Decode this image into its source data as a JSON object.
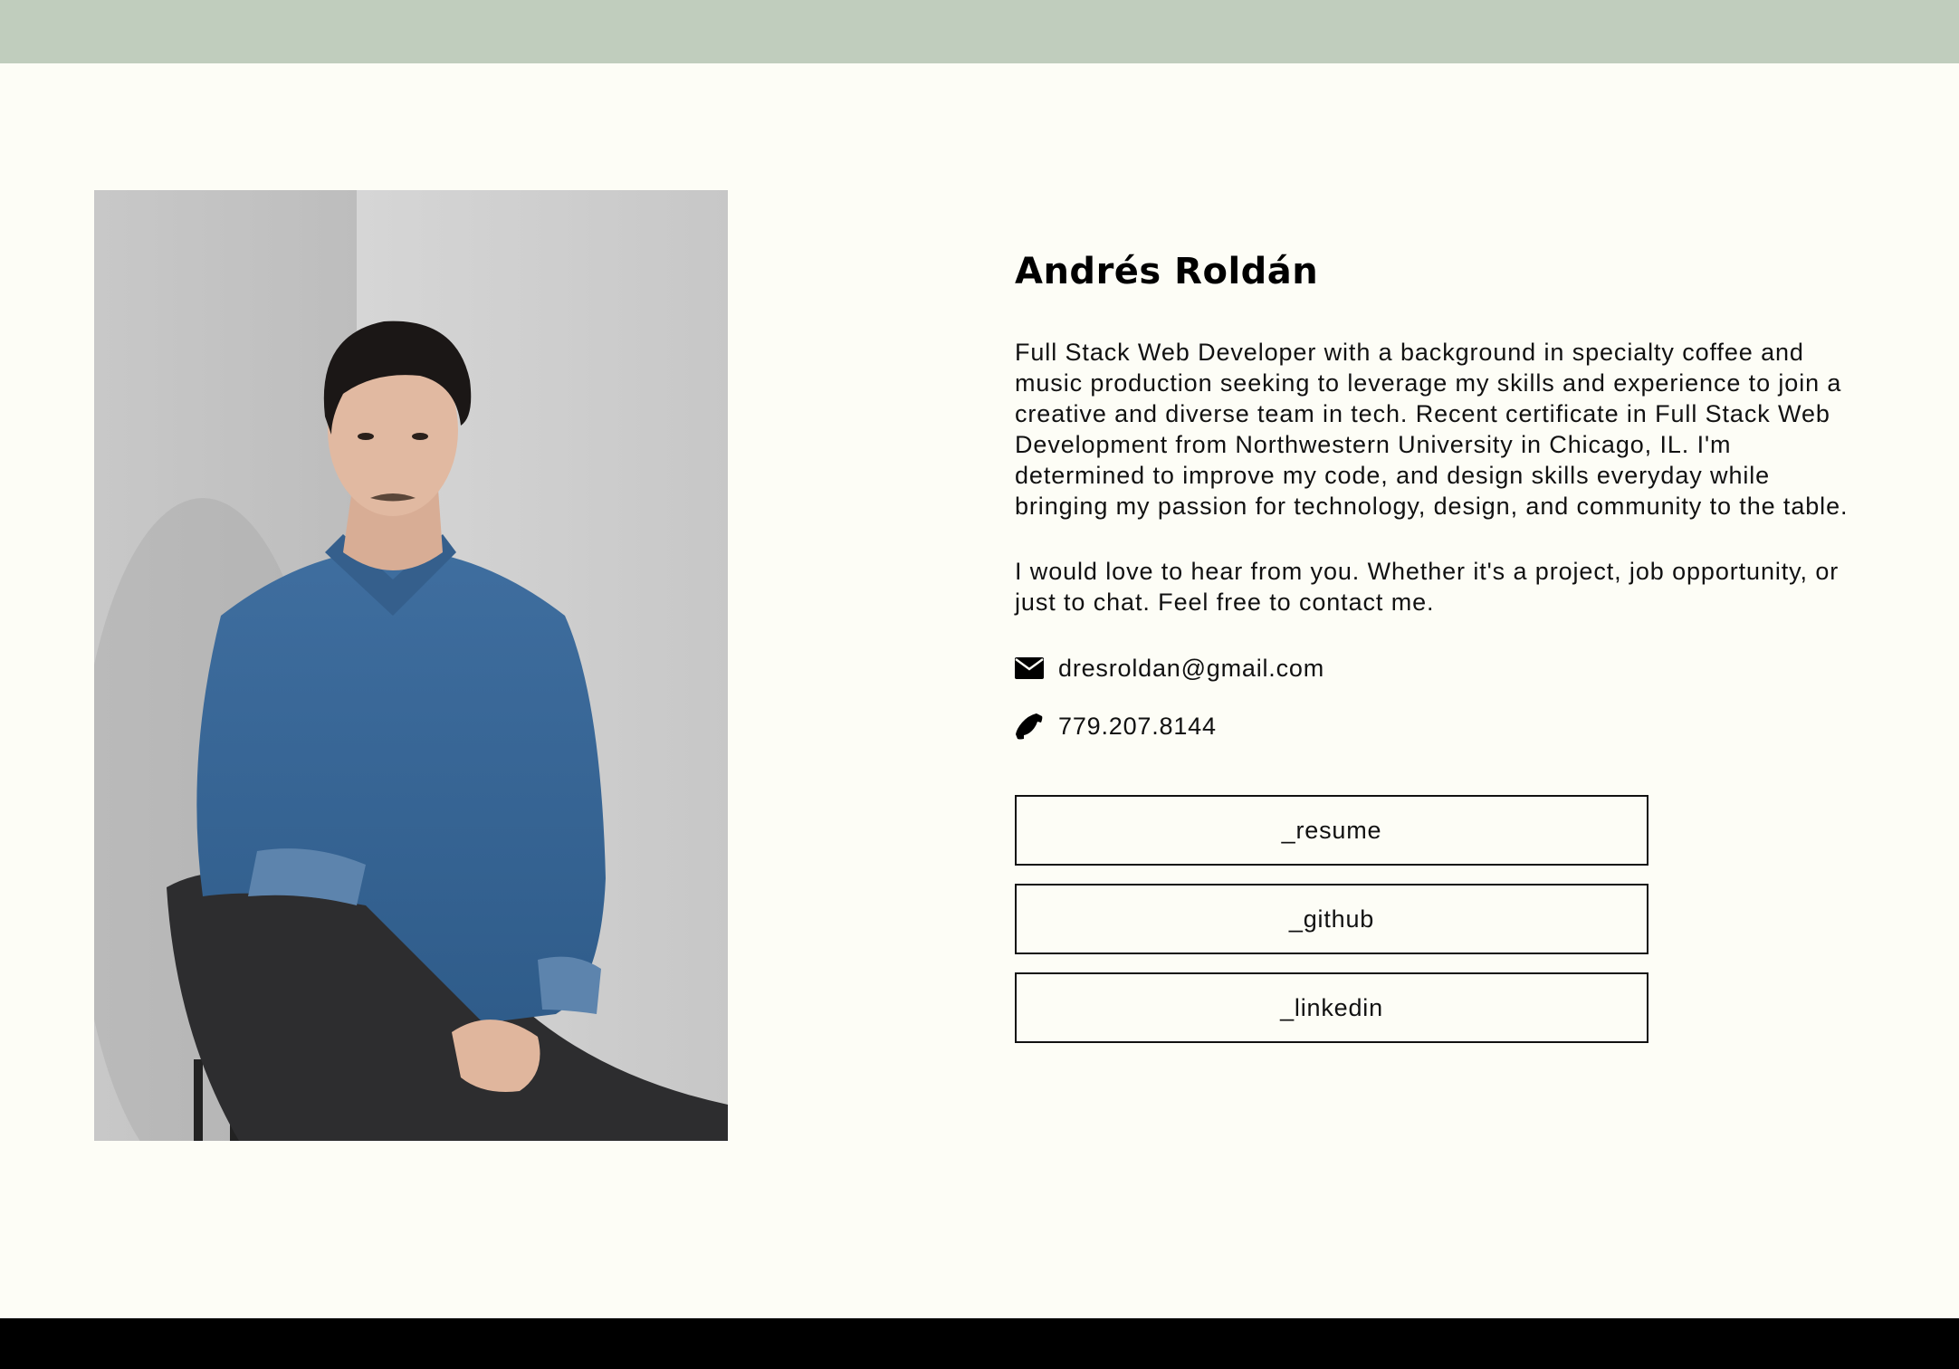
{
  "profile": {
    "name": "Andrés Roldán",
    "bio": "Full Stack Web Developer with a background in specialty coffee and music production seeking to leverage my skills and experience to join a creative and diverse team in tech. Recent certificate in Full Stack Web Development from Northwestern University in Chicago, IL. I'm determined to improve my code, and design skills everyday while bringing my passion for technology, design, and community to the table.",
    "contact_blurb": "I would love to hear from you. Whether it's a project, job opportunity, or just to chat. Feel free to contact me."
  },
  "contact": {
    "email": "dresroldan@gmail.com",
    "email_icon": "envelope-icon",
    "phone": "779.207.8144",
    "phone_icon": "phone-icon"
  },
  "links": {
    "resume_label": "_resume",
    "github_label": "_github",
    "linkedin_label": "_linkedin"
  },
  "colors": {
    "background": "#fdfdf6",
    "top_bar": "#c0cdbd",
    "bottom_bar": "#000000",
    "text": "#111111"
  }
}
